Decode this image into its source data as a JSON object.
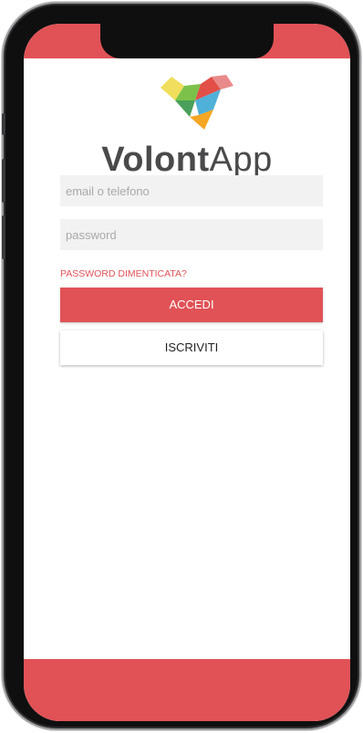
{
  "app": {
    "name_bold": "Volont",
    "name_light": "App"
  },
  "login": {
    "email_placeholder": "email o telefono",
    "password_placeholder": "password",
    "forgot_label": "PASSWORD DIMENTICATA?",
    "login_label": "ACCEDI",
    "signup_label": "ISCRIVITI"
  },
  "colors": {
    "accent": "#e05256",
    "frame": "#0f0f10",
    "field_bg": "#f2f2f2"
  },
  "icons": {
    "logo": "heart-logo-icon"
  }
}
